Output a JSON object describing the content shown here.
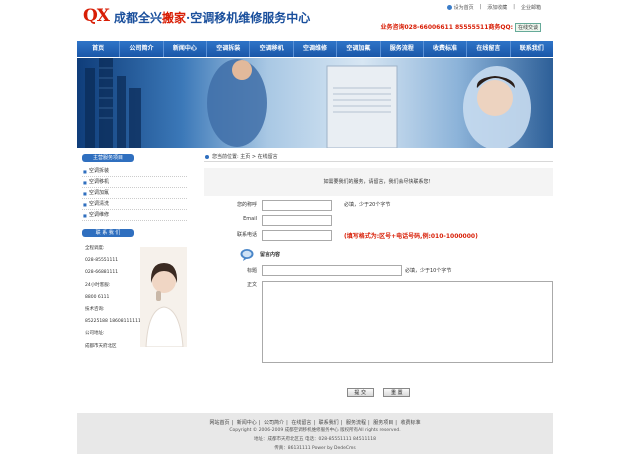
{
  "header": {
    "logo_mark": "QX",
    "logo_part1": "成都全兴",
    "logo_part2": "搬家",
    "logo_part3": "·空调移机维修服务中心",
    "top_links": [
      "设为首页",
      "添加收藏",
      "企业邮箱"
    ],
    "hotline": "业务咨询028-66006611 85555511商务QQ:",
    "qq_label": "在线交谈"
  },
  "nav": [
    "首页",
    "公司简介",
    "新闻中心",
    "空调拆装",
    "空调移机",
    "空调维修",
    "空调加氟",
    "服务流程",
    "收费标准",
    "在线留言",
    "联系我们"
  ],
  "sidebar": {
    "services_title": "主营服务项目",
    "services": [
      "空调拆装",
      "空调移机",
      "空调加氟",
      "空调清洗",
      "空调维修"
    ],
    "contact_title": "联 系 我 们",
    "contact_lines": [
      "全程调度:",
      "028-85551111",
      "028-66881111",
      "24小时客服:",
      "8800 6111",
      "技术咨询:",
      "85225188 18608111111",
      "公司地址:",
      "成都市天府北区"
    ]
  },
  "main": {
    "breadcrumb": "您当前位置: 主页 > 在线留言",
    "intro": "如需要我们的服务，请留言，我们会尽快联系您！",
    "fields": [
      {
        "label": "您的称呼",
        "hint": "必填，少于20个字节"
      },
      {
        "label": "Email",
        "hint": ""
      },
      {
        "label": "联系电话",
        "hint": "(填写格式为:区号+电话号码,例:010-1000000)"
      }
    ],
    "message_title": "留言内容",
    "subject_label": "标题",
    "subject_hint": "必填，少于10个字节",
    "body_label": "正文",
    "submit_label": "提 交",
    "reset_label": "重 置"
  },
  "footer": {
    "links": [
      "网站首页",
      "新闻中心",
      "公司简介",
      "在线留言",
      "联系我们",
      "服务流程",
      "服务项目",
      "收费标准"
    ],
    "copyright": "Copyright © 2006-2009 成都空调移机维修服务中心 版权所有All rights reserved.",
    "address": "地址：成都市天府北区五 电话：028-85551111 84511118",
    "fax": "传真：86131111  Power by DedeCms"
  }
}
